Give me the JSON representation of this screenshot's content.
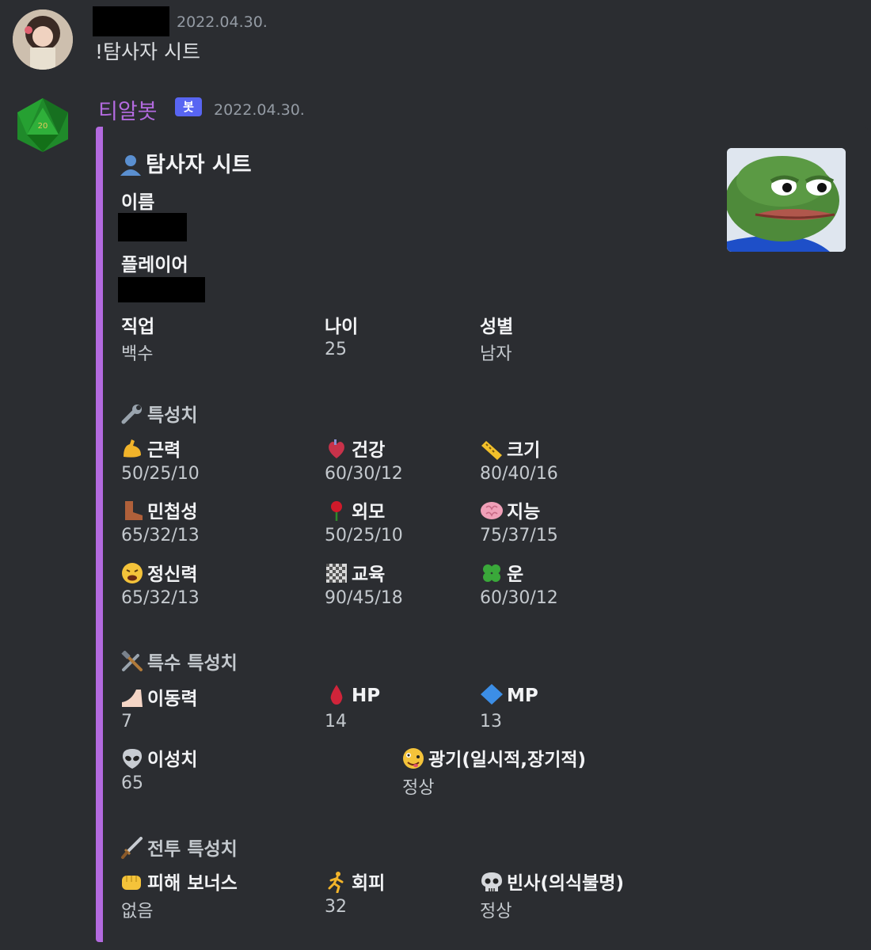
{
  "message1": {
    "timestamp": "2022.04.30.",
    "text": "!탐사자 시트"
  },
  "message2": {
    "author": "티알봇",
    "badge": "봇",
    "timestamp": "2022.04.30."
  },
  "embed": {
    "accent_color": "#b36adf",
    "title": "탐사자 시트",
    "title_icon": "bust-in-silhouette-icon",
    "fields": {
      "name_label": "이름",
      "player_label": "플레이어",
      "job_label": "직업",
      "job_value": "백수",
      "age_label": "나이",
      "age_value": "25",
      "sex_label": "성별",
      "sex_value": "남자"
    },
    "sections": {
      "traits": "특성치",
      "special": "특수 특성치",
      "combat": "전투 특성치"
    },
    "traits": [
      {
        "icon": "flexed-biceps-icon",
        "label": "근력",
        "value": "50/25/10"
      },
      {
        "icon": "anatomical-heart-icon",
        "label": "건강",
        "value": "60/30/12"
      },
      {
        "icon": "ruler-icon",
        "label": "크기",
        "value": "80/40/16"
      },
      {
        "icon": "boot-icon",
        "label": "민첩성",
        "value": "65/32/13"
      },
      {
        "icon": "rose-icon",
        "label": "외모",
        "value": "50/25/10"
      },
      {
        "icon": "brain-icon",
        "label": "지능",
        "value": "75/37/15"
      },
      {
        "icon": "tired-face-icon",
        "label": "정신력",
        "value": "65/32/13"
      },
      {
        "icon": "checkerboard-icon",
        "label": "교육",
        "value": "90/45/18"
      },
      {
        "icon": "four-leaf-clover-icon",
        "label": "운",
        "value": "60/30/12"
      }
    ],
    "special": [
      {
        "icon": "foot-icon",
        "label": "이동력",
        "value": "7"
      },
      {
        "icon": "blood-drop-icon",
        "label": "HP",
        "value": "14"
      },
      {
        "icon": "blue-diamond-icon",
        "label": "MP",
        "value": "13"
      },
      {
        "icon": "alien-icon",
        "label": "이성치",
        "value": "65"
      },
      {
        "icon": "zany-face-icon",
        "label": "광기(일시적,장기적)",
        "value": "정상"
      }
    ],
    "combat": [
      {
        "icon": "fist-icon",
        "label": "피해 보너스",
        "value": "없음"
      },
      {
        "icon": "runner-icon",
        "label": "회피",
        "value": "32"
      },
      {
        "icon": "skull-icon",
        "label": "빈사(의식불명)",
        "value": "정상"
      }
    ]
  }
}
